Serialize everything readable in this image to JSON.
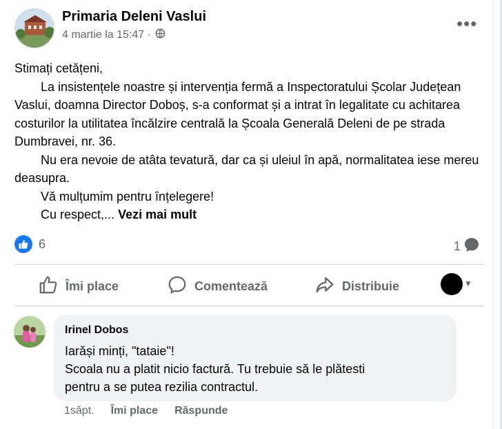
{
  "post": {
    "page_name": "Primaria Deleni Vaslui",
    "timestamp": "4 martie la 15:47 ·",
    "menu": "•••",
    "body": {
      "line1": "Stimați cetățeni,",
      "para1": "La insistențele noastre și intervenția fermă a Inspectoratului Școlar Județean Vaslui, doamna Director Doboș, s-a conformat și a intrat în legalitate cu achitarea costurilor la utilitatea încălzire centrală la Școala Generală Deleni  de pe strada Dumbravei, nr. 36.",
      "para2": "Nu era nevoie de atâta tevatură, dar ca și uleiul în apă, normalitatea iese mereu deasupra.",
      "para3": "Vă mulțumim pentru înțelegere!",
      "para4": "Cu respect,...",
      "see_more": "Vezi mai mult"
    },
    "reactions_count": "6",
    "comments_count": "1"
  },
  "actions": {
    "like": "Îmi place",
    "comment": "Comentează",
    "share": "Distribuie"
  },
  "comment": {
    "author": "Irinel Dobos",
    "lines": [
      "Iarăși minți, \"tataie\"!",
      "Scoala nu a platit nicio factură. Tu trebuie să le plătesti",
      "pentru a se putea rezilia contractul."
    ],
    "time": "1săpt.",
    "like": "Îmi place",
    "reply": "Răspunde"
  },
  "colors": {
    "facebook_blue": "#1877f2",
    "secondary_text": "#65676b",
    "comment_bg": "#f0f2f5"
  }
}
